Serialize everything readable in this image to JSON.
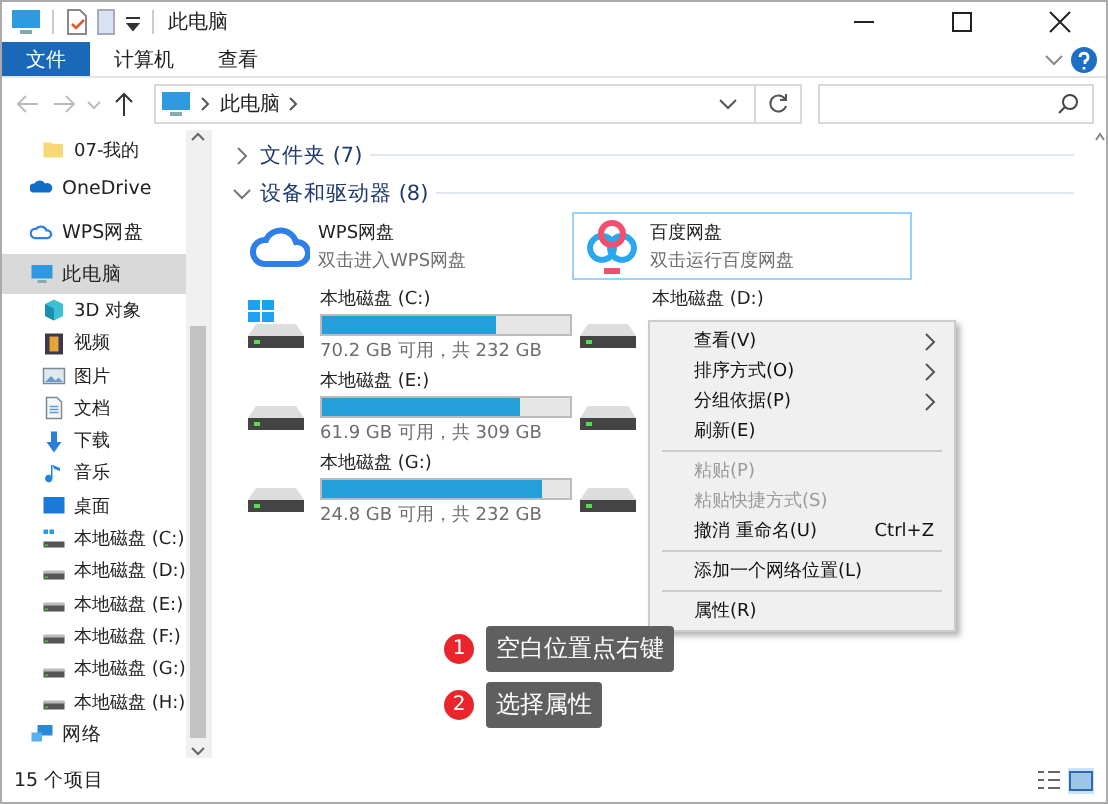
{
  "window": {
    "title": "此电脑"
  },
  "ribbon_tabs": [
    {
      "label": "文件",
      "selected": true
    },
    {
      "label": "计算机",
      "selected": false
    },
    {
      "label": "查看",
      "selected": false
    }
  ],
  "address": {
    "path": "此电脑"
  },
  "sidebar": {
    "items": [
      {
        "kind": "folder",
        "label": "07-我的",
        "selected": false
      },
      {
        "kind": "onedrive",
        "label": "OneDrive",
        "selected": false
      },
      {
        "kind": "cloud",
        "label": "WPS网盘",
        "selected": false
      },
      {
        "kind": "pc",
        "label": "此电脑",
        "selected": true,
        "children": [
          {
            "kind": "cube",
            "label": "3D 对象",
            "selected": false
          },
          {
            "kind": "video",
            "label": "视频",
            "selected": false
          },
          {
            "kind": "image",
            "label": "图片",
            "selected": false
          },
          {
            "kind": "doc",
            "label": "文档",
            "selected": false
          },
          {
            "kind": "download",
            "label": "下载",
            "selected": false
          },
          {
            "kind": "music",
            "label": "音乐",
            "selected": false
          },
          {
            "kind": "desktop",
            "label": "桌面",
            "selected": false
          },
          {
            "kind": "sysdrive",
            "label": "本地磁盘 (C:)",
            "selected": false
          },
          {
            "kind": "drive",
            "label": "本地磁盘 (D:)",
            "selected": false
          },
          {
            "kind": "drive",
            "label": "本地磁盘 (E:)",
            "selected": false
          },
          {
            "kind": "drive",
            "label": "本地磁盘 (F:)",
            "selected": false
          },
          {
            "kind": "drive",
            "label": "本地磁盘 (G:)",
            "selected": false
          },
          {
            "kind": "drive",
            "label": "本地磁盘 (H:)",
            "selected": false
          }
        ]
      },
      {
        "kind": "network",
        "label": "网络",
        "selected": false
      }
    ]
  },
  "groups": [
    {
      "label": "文件夹 (7)",
      "expanded": false
    },
    {
      "label": "设备和驱动器 (8)",
      "expanded": true,
      "items": [
        {
          "kind": "app",
          "name": "WPS网盘",
          "subtitle": "双击进入WPS网盘",
          "selected": false
        },
        {
          "kind": "app",
          "name": "百度网盘",
          "subtitle": "双击运行百度网盘",
          "selected": true
        },
        {
          "kind": "drive",
          "system": true,
          "name": "本地磁盘 (C:)",
          "level": 0.7,
          "reading": "70.2 GB 可用，共 232 GB"
        },
        {
          "kind": "drive",
          "system": false,
          "name": "本地磁盘 (D:)"
        },
        {
          "kind": "drive",
          "system": false,
          "name": "本地磁盘 (E:)",
          "level": 0.8,
          "reading": "61.9 GB 可用，共 309 GB"
        },
        {
          "kind": "drive",
          "system": false
        },
        {
          "kind": "drive",
          "system": false,
          "name": "本地磁盘 (G:)",
          "level": 0.89,
          "reading": "24.8 GB 可用，共 232 GB"
        },
        {
          "kind": "drive",
          "system": false
        }
      ]
    }
  ],
  "context_menu": {
    "items": [
      {
        "kind": "item",
        "label": "查看(V)",
        "submenu": true,
        "disabled": false
      },
      {
        "kind": "item",
        "label": "排序方式(O)",
        "submenu": true,
        "disabled": false
      },
      {
        "kind": "item",
        "label": "分组依据(P)",
        "submenu": true,
        "disabled": false
      },
      {
        "kind": "item",
        "label": "刷新(E)",
        "submenu": false,
        "disabled": false
      },
      {
        "kind": "separator"
      },
      {
        "kind": "item",
        "label": "粘贴(P)",
        "submenu": false,
        "disabled": true
      },
      {
        "kind": "item",
        "label": "粘贴快捷方式(S)",
        "submenu": false,
        "disabled": true
      },
      {
        "kind": "item",
        "label": "撤消 重命名(U)",
        "shortcut": "Ctrl+Z",
        "submenu": false,
        "disabled": false
      },
      {
        "kind": "separator"
      },
      {
        "kind": "item",
        "label": "添加一个网络位置(L)",
        "submenu": false,
        "disabled": false
      },
      {
        "kind": "separator"
      },
      {
        "kind": "item",
        "label": "属性(R)",
        "submenu": false,
        "disabled": false
      }
    ]
  },
  "callouts": [
    {
      "number": "1",
      "text": "空白位置点右键"
    },
    {
      "number": "2",
      "text": "选择属性"
    }
  ],
  "status_bar": {
    "text": "15 个项目",
    "view_buttons": [
      {
        "kind": "details",
        "selected": false
      },
      {
        "kind": "tiles",
        "selected": true
      }
    ]
  }
}
